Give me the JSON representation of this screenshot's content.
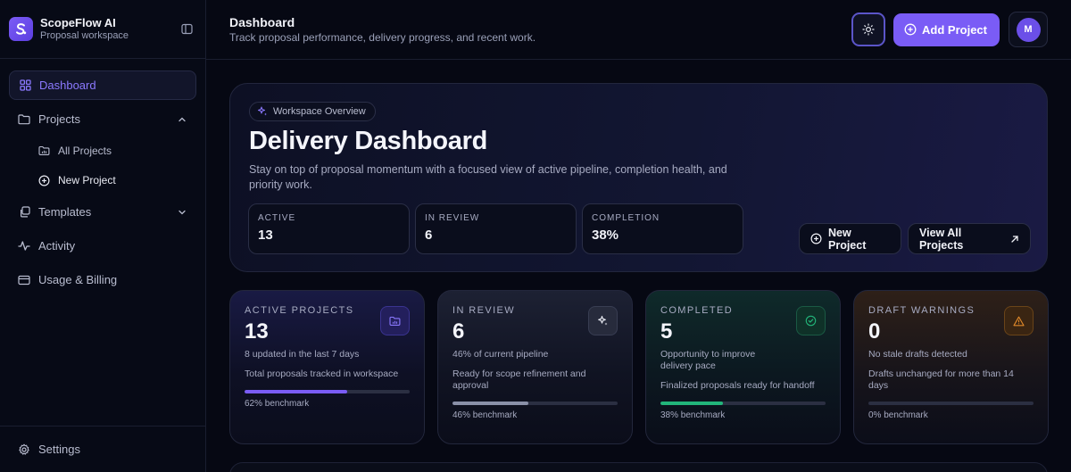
{
  "brand": {
    "name": "ScopeFlow AI",
    "subtitle": "Proposal workspace"
  },
  "sidebar": {
    "items": [
      {
        "label": "Dashboard",
        "icon": "grid-icon",
        "active": true
      },
      {
        "label": "Projects",
        "icon": "folder-icon",
        "expanded": true,
        "children": [
          {
            "label": "All Projects",
            "icon": "folder-open-icon"
          },
          {
            "label": "New Project",
            "icon": "plus-circle-icon"
          }
        ]
      },
      {
        "label": "Templates",
        "icon": "copy-icon",
        "expanded": false
      },
      {
        "label": "Activity",
        "icon": "activity-icon"
      },
      {
        "label": "Usage & Billing",
        "icon": "card-icon"
      }
    ],
    "footer": {
      "label": "Settings",
      "icon": "gear-icon"
    }
  },
  "topbar": {
    "title": "Dashboard",
    "subtitle": "Track proposal performance, delivery progress, and recent work.",
    "add_label": "Add Project",
    "avatar_initial": "M"
  },
  "hero": {
    "pill": "Workspace Overview",
    "title": "Delivery Dashboard",
    "description": "Stay on top of proposal momentum with a focused view of active pipeline, completion health, and priority work.",
    "stats": [
      {
        "label": "ACTIVE",
        "value": "13"
      },
      {
        "label": "IN REVIEW",
        "value": "6"
      },
      {
        "label": "COMPLETION",
        "value": "38%"
      }
    ],
    "new_project_label": "New Project",
    "view_all_label": "View All Projects"
  },
  "cards": [
    {
      "label": "ACTIVE PROJECTS",
      "value": "13",
      "sub": "8 updated in the last 7 days",
      "note": "Total proposals tracked in workspace",
      "progress": 0.62,
      "bench": "62% benchmark",
      "color": "#7a5cf6",
      "icon": "folder-icon"
    },
    {
      "label": "IN REVIEW",
      "value": "6",
      "sub": "46% of current pipeline",
      "note": "Ready for scope refinement and approval",
      "progress": 0.46,
      "bench": "46% benchmark",
      "color": "#8a90a8",
      "icon": "sparkle-icon"
    },
    {
      "label": "COMPLETED",
      "value": "5",
      "sub": "Opportunity to improve delivery pace",
      "note": "Finalized proposals ready for handoff",
      "progress": 0.38,
      "bench": "38% benchmark",
      "color": "#22b57a",
      "icon": "check-circle-icon"
    },
    {
      "label": "DRAFT WARNINGS",
      "value": "0",
      "sub": "No stale drafts detected",
      "note": "Drafts unchanged for more than 14 days",
      "progress": 0,
      "bench": "0% benchmark",
      "color": "#e0892a",
      "icon": "warning-icon"
    }
  ]
}
